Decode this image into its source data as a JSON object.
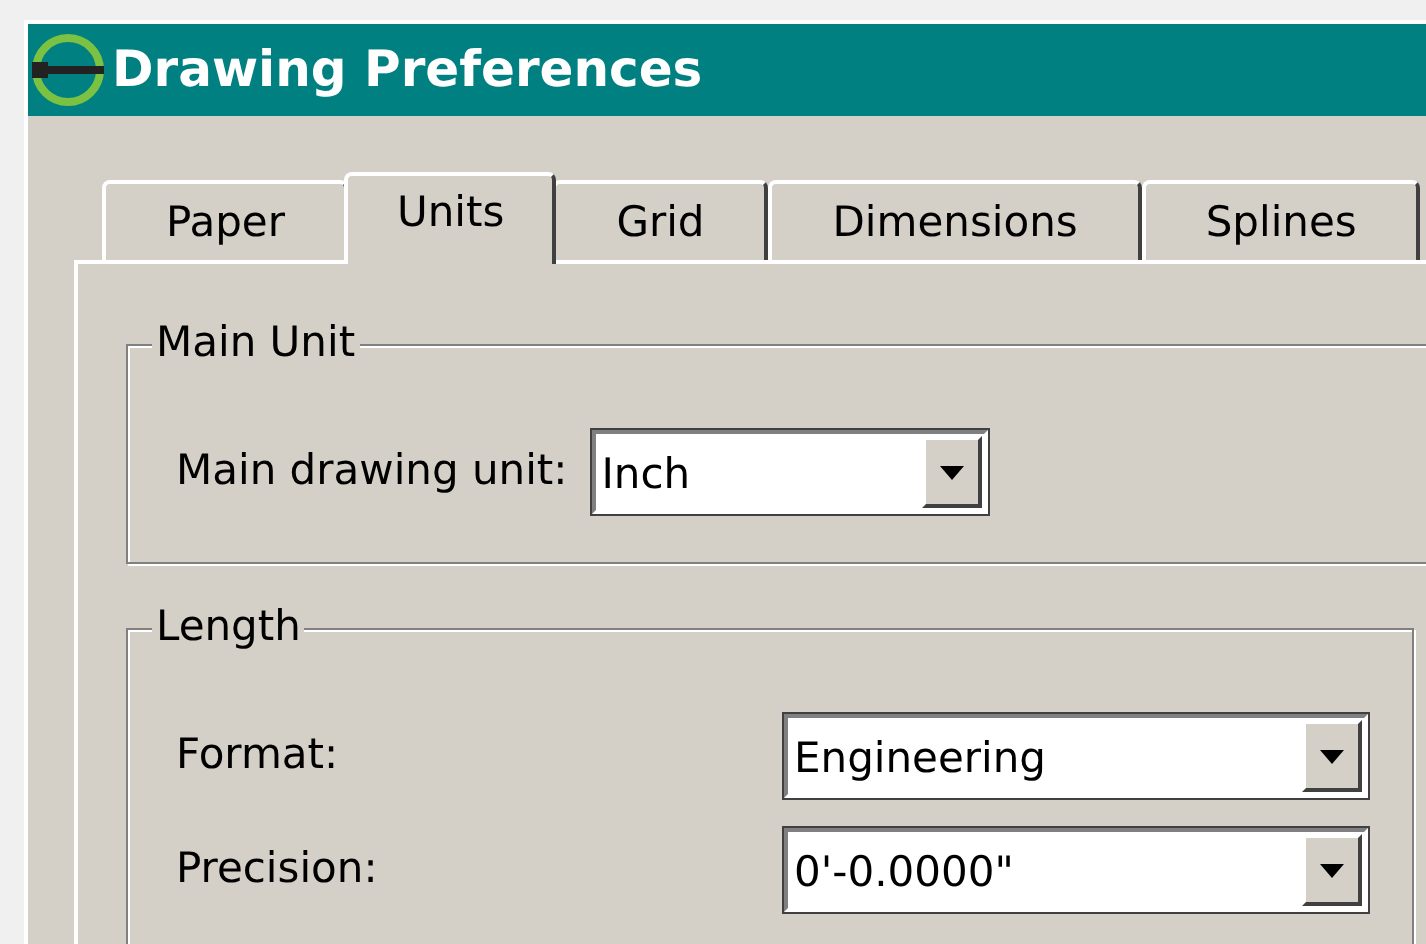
{
  "window": {
    "title": "Drawing Preferences"
  },
  "tabs": [
    {
      "label": "Paper",
      "selected": false
    },
    {
      "label": "Units",
      "selected": true
    },
    {
      "label": "Grid",
      "selected": false
    },
    {
      "label": "Dimensions",
      "selected": false
    },
    {
      "label": "Splines",
      "selected": false
    }
  ],
  "main_unit": {
    "title": "Main Unit",
    "fields": [
      {
        "label": "Main drawing unit:",
        "value": "Inch"
      }
    ]
  },
  "length": {
    "title": "Length",
    "fields": [
      {
        "label": "Format:",
        "value": "Engineering"
      },
      {
        "label": "Precision:",
        "value": "0'-0.0000\""
      }
    ]
  }
}
